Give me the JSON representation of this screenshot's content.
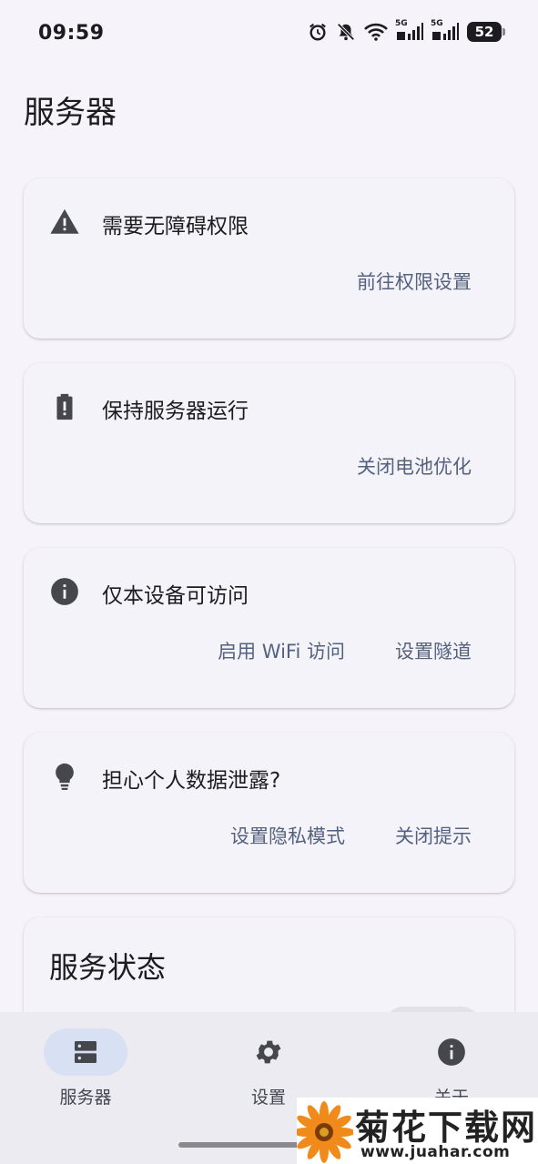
{
  "status_bar": {
    "time": "09:59",
    "battery": "52",
    "signal_label": "5G",
    "icons": [
      "alarm-icon",
      "bell-muted-icon",
      "wifi-icon",
      "signal-5g-icon",
      "signal-5g-icon",
      "battery-icon"
    ]
  },
  "page": {
    "title": "服务器"
  },
  "cards": [
    {
      "icon": "warning-icon",
      "title": "需要无障碍权限",
      "actions": [
        "前往权限设置"
      ]
    },
    {
      "icon": "battery-alert-icon",
      "title": "保持服务器运行",
      "actions": [
        "关闭电池优化"
      ]
    },
    {
      "icon": "info-icon",
      "title": "仅本设备可访问",
      "actions": [
        "启用 WiFi 访问",
        "设置隧道"
      ]
    },
    {
      "icon": "lightbulb-icon",
      "title": "担心个人数据泄露?",
      "actions": [
        "设置隐私模式",
        "关闭提示"
      ]
    }
  ],
  "status_card": {
    "title": "服务状态"
  },
  "bottom_nav": {
    "items": [
      {
        "label": "服务器",
        "icon": "server-icon",
        "active": true
      },
      {
        "label": "设置",
        "icon": "gear-icon",
        "active": false
      },
      {
        "label": "关于",
        "icon": "info-icon",
        "active": false
      }
    ]
  },
  "watermark": {
    "title": "菊花下载网",
    "url": "www.juahar.com"
  },
  "colors": {
    "background": "#f6f4fa",
    "card": "#f4f3f9",
    "action_text": "#54627f",
    "nav_active_indicator": "#d8e0f3",
    "icon": "#45474c"
  }
}
